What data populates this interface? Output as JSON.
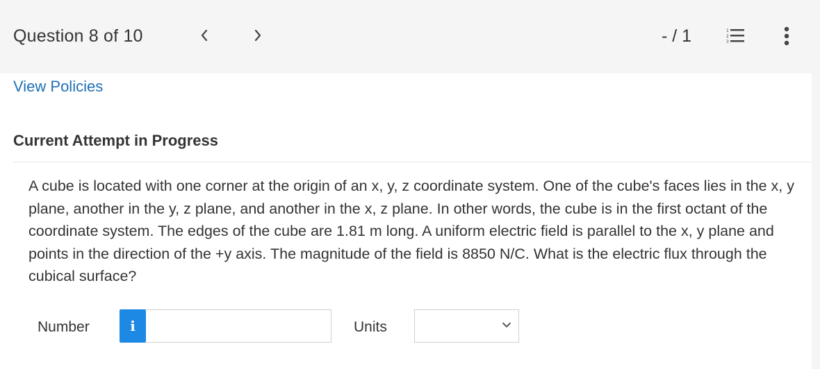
{
  "header": {
    "title": "Question 8 of 10",
    "score": "- / 1",
    "prev_icon": "chevron-left-icon",
    "next_icon": "chevron-right-icon",
    "list_icon": "numbered-list-icon",
    "more_icon": "vertical-ellipsis-icon"
  },
  "links": {
    "view_policies": "View Policies"
  },
  "attempt": {
    "status": "Current Attempt in Progress"
  },
  "question": {
    "text": "A cube is located with one corner at the origin of an x, y, z coordinate system. One of the cube's faces lies in the x, y plane, another in the y, z plane, and another in the x, z plane. In other words, the cube is in the first octant of the coordinate system. The edges of the cube are 1.81 m long. A uniform electric field is parallel to the x, y plane and points in the direction of the +y axis. The magnitude of the field is 8850 N/C. What is the electric flux through the cubical surface?"
  },
  "answer": {
    "number_label": "Number",
    "info_glyph": "i",
    "number_value": "",
    "units_label": "Units",
    "units_selected": ""
  },
  "colors": {
    "link": "#1f6fb5",
    "info_button": "#1e88e5",
    "header_bg": "#f5f5f5",
    "content_bg": "#ffffff"
  }
}
